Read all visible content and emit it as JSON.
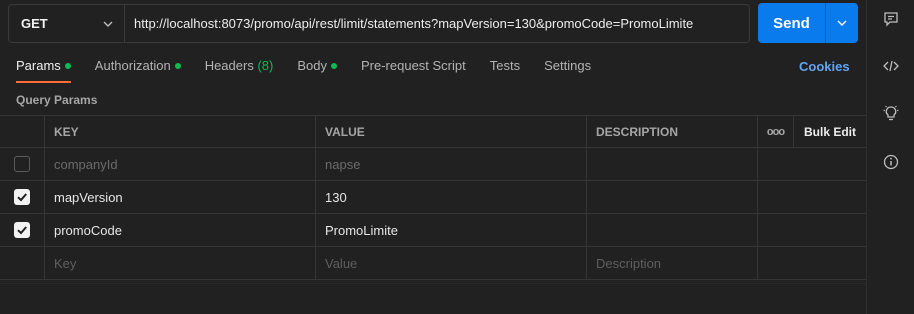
{
  "request": {
    "method": "GET",
    "url": "http://localhost:8073/promo/api/rest/limit/statements?mapVersion=130&promoCode=PromoLimite",
    "send_label": "Send"
  },
  "tabs": [
    {
      "label": "Params",
      "dot": true
    },
    {
      "label": "Authorization",
      "dot": true
    },
    {
      "label": "Headers",
      "badge": "(8)"
    },
    {
      "label": "Body",
      "dot": true
    },
    {
      "label": "Pre-request Script"
    },
    {
      "label": "Tests"
    },
    {
      "label": "Settings"
    }
  ],
  "active_tab": "Params",
  "cookies_label": "Cookies",
  "section_title": "Query Params",
  "table": {
    "headers": {
      "key": "KEY",
      "value": "VALUE",
      "description": "DESCRIPTION",
      "more": "ooo",
      "bulk_edit": "Bulk Edit"
    },
    "rows": [
      {
        "checked": false,
        "key": "companyId",
        "value": "napse",
        "description": ""
      },
      {
        "checked": true,
        "key": "mapVersion",
        "value": "130",
        "description": ""
      },
      {
        "checked": true,
        "key": "promoCode",
        "value": "PromoLimite",
        "description": ""
      }
    ],
    "placeholders": {
      "key": "Key",
      "value": "Value",
      "description": "Description"
    }
  },
  "rail_icons": [
    "comment-icon",
    "code-icon",
    "lightbulb-icon",
    "info-icon"
  ],
  "colors": {
    "accent": "#ff6c37",
    "send": "#097bed",
    "dot": "#0cbb52",
    "link": "#5ea6f5"
  }
}
